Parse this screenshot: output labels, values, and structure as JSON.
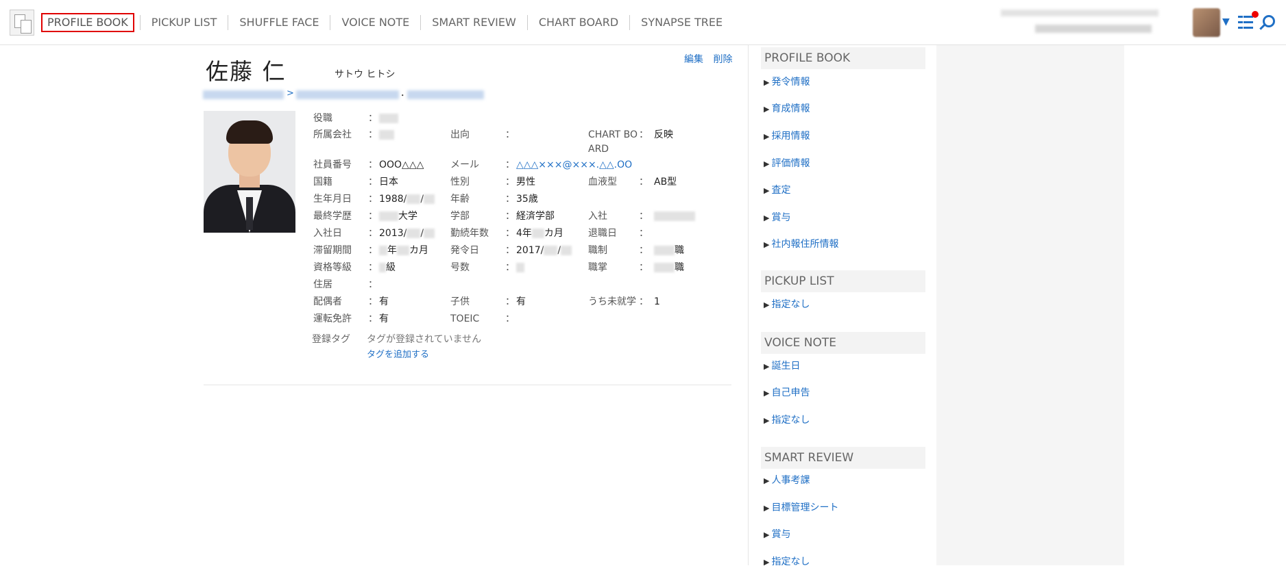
{
  "nav": {
    "items": [
      {
        "label": "PROFILE BOOK"
      },
      {
        "label": "PICKUP LIST"
      },
      {
        "label": "SHUFFLE FACE"
      },
      {
        "label": "VOICE NOTE"
      },
      {
        "label": "SMART REVIEW"
      },
      {
        "label": "CHART BOARD"
      },
      {
        "label": "SYNAPSE TREE"
      }
    ]
  },
  "header_icons": {
    "caret": "▼",
    "icons": [
      "user-avatar",
      "caret-down-icon",
      "task-list-icon",
      "notification-dot",
      "search-icon"
    ],
    "accent": "#1f6fc5",
    "alert": "#e00000"
  },
  "profile": {
    "name": "佐藤 仁",
    "kana": "サトウ ヒトシ",
    "edit_label": "編集",
    "delete_label": "削除",
    "crumb_sep1": ">",
    "crumb_sep2": "･",
    "colon": "：",
    "rows": {
      "yakushoku": {
        "label": "役職"
      },
      "shozoku": {
        "label": "所属会社",
        "col2_label": "出向",
        "col3_label": "CHART BO",
        "col3_label2": "ARD",
        "col3_value": "反映"
      },
      "shain": {
        "label": "社員番号",
        "value": "OOO△△△",
        "col2_label": "メール",
        "col2_value": "△△△×××@×××.△△.OO"
      },
      "kokuseki": {
        "label": "国籍",
        "value": "日本",
        "col2_label": "性別",
        "col2_value": "男性",
        "col3_label": "血液型",
        "col3_value": "AB型"
      },
      "seinen": {
        "label": "生年月日",
        "value_prefix": "1988/",
        "value_sep": "/",
        "col2_label": "年齢",
        "col2_value": "35歳"
      },
      "gakureki": {
        "label": "最終学歴",
        "value_suffix": "大学",
        "col2_label": "学部",
        "col2_value": "経済学部",
        "col3_label": "入社"
      },
      "nyusha": {
        "label": "入社日",
        "value_prefix": "2013/",
        "value_sep": "/",
        "col2_label": "勤続年数",
        "col2_prefix": "4年",
        "col2_suffix": "カ月",
        "col3_label": "退職日"
      },
      "taizai": {
        "label": "滞留期間",
        "value_mid": "年",
        "value_suffix": "カ月",
        "col2_label": "発令日",
        "col2_prefix": "2017/",
        "col2_sep": "/",
        "col3_label": "職制",
        "col3_suffix": "職"
      },
      "shikaku": {
        "label": "資格等級",
        "value_suffix": "級",
        "col2_label": "号数",
        "col3_label": "職掌",
        "col3_suffix": "職"
      },
      "jukyo": {
        "label": "住居"
      },
      "haigusha": {
        "label": "配偶者",
        "value": "有",
        "col2_label": "子供",
        "col2_value": "有",
        "col3_label": "うち未就学",
        "col3_value": "1"
      },
      "unten": {
        "label": "運転免許",
        "value": "有",
        "col2_label": "TOEIC"
      }
    },
    "tags": {
      "label": "登録タグ",
      "empty": "タグが登録されていません",
      "add": "タグを追加する"
    }
  },
  "sidebar": {
    "arrow": "▶",
    "sections": [
      {
        "title": "PROFILE BOOK",
        "items": [
          "発令情報",
          "育成情報",
          "採用情報",
          "評価情報",
          "査定",
          "賞与",
          "社内報住所情報"
        ]
      },
      {
        "title": "PICKUP LIST",
        "items": [
          "指定なし"
        ]
      },
      {
        "title": "VOICE NOTE",
        "items": [
          "誕生日",
          "自己申告",
          "指定なし"
        ]
      },
      {
        "title": "SMART REVIEW",
        "items": [
          "人事考課",
          "目標管理シート",
          "賞与",
          "指定なし"
        ]
      }
    ]
  }
}
